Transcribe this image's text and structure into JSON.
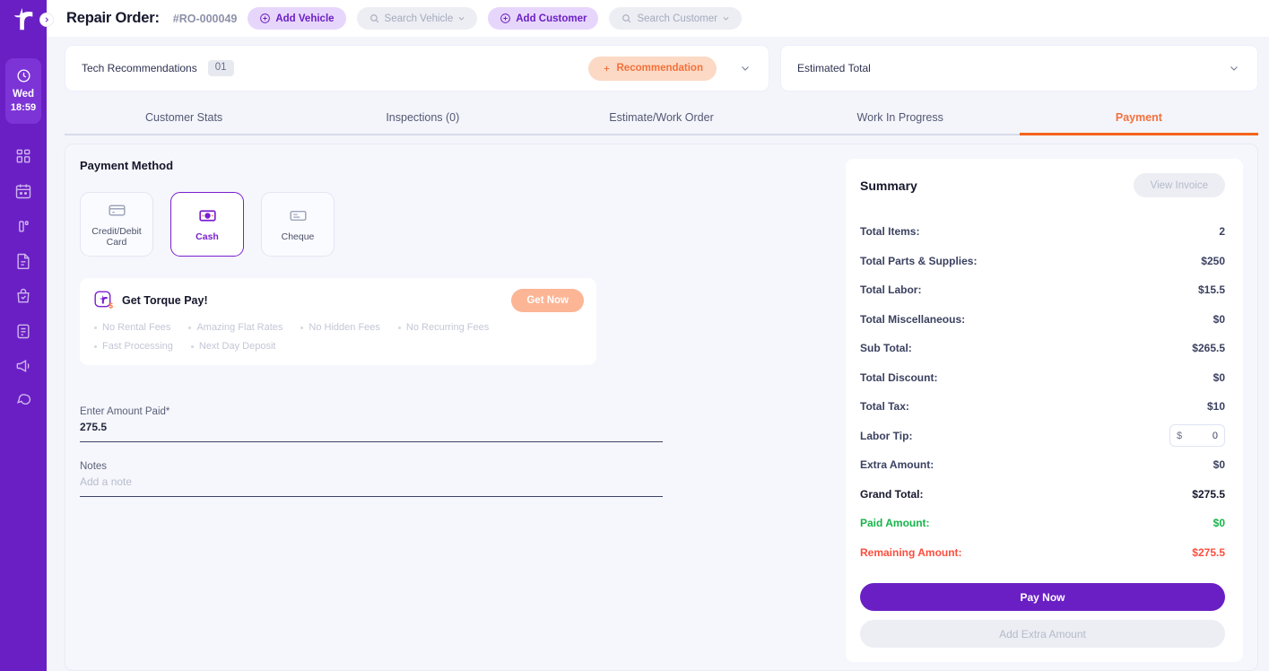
{
  "sidebar": {
    "logo_icon": "torque-logo",
    "toggle_icon": "chevron-right-icon",
    "time_widget": {
      "icon": "clock-icon",
      "day": "Wed",
      "time": "18:59"
    },
    "nav_items": [
      {
        "icon": "dashboard-grid-icon",
        "name": "dashboard"
      },
      {
        "icon": "calendar-icon",
        "name": "calendar"
      },
      {
        "icon": "chart-bars-icon",
        "name": "reports"
      },
      {
        "icon": "document-icon",
        "name": "documents"
      },
      {
        "icon": "shopping-bag-check-icon",
        "name": "orders"
      },
      {
        "icon": "clipboard-list-icon",
        "name": "inventory"
      },
      {
        "icon": "megaphone-icon",
        "name": "marketing"
      },
      {
        "icon": "chat-bubbles-icon",
        "name": "messages"
      }
    ]
  },
  "header": {
    "title": "Repair Order:",
    "order_number": "#RO-000049",
    "add_vehicle": "Add Vehicle",
    "search_vehicle": "Search Vehicle",
    "add_customer": "Add Customer",
    "search_customer": "Search Customer",
    "plus_icon": "plus-circle-icon",
    "search_icon": "search-icon",
    "chevron_icon": "chevron-down-icon"
  },
  "strips": {
    "tech_recommendations_label": "Tech Recommendations",
    "tech_recommendations_count": "01",
    "recommendation_button": "Recommendation",
    "recommendation_plus_icon": "plus-icon",
    "estimated_total_label": "Estimated Total",
    "expand_icon": "chevron-down-icon"
  },
  "tabs": [
    {
      "label": "Customer Stats",
      "active": false
    },
    {
      "label": "Inspections (0)",
      "active": false
    },
    {
      "label": "Estimate/Work Order",
      "active": false
    },
    {
      "label": "Work In Progress",
      "active": false
    },
    {
      "label": "Payment",
      "active": true
    }
  ],
  "payment": {
    "section_title": "Payment Method",
    "methods": [
      {
        "label": "Credit/Debit Card",
        "icon": "credit-card-icon",
        "selected": false
      },
      {
        "label": "Cash",
        "icon": "cash-banknote-icon",
        "selected": true
      },
      {
        "label": "Cheque",
        "icon": "cheque-icon",
        "selected": false
      }
    ],
    "promo": {
      "logo_icon": "torque-pay-logo-icon",
      "title": "Get Torque Pay!",
      "cta": "Get Now",
      "features": [
        "No Rental Fees",
        "Amazing Flat Rates",
        "No Hidden Fees",
        "No Recurring Fees",
        "Fast Processing",
        "Next Day Deposit"
      ]
    },
    "amount_label": "Enter Amount Paid*",
    "amount_value": "275.5",
    "notes_label": "Notes",
    "notes_placeholder": "Add a note",
    "notes_value": ""
  },
  "summary": {
    "title": "Summary",
    "view_invoice": "View Invoice",
    "rows": [
      {
        "key": "Total Items:",
        "value": "2",
        "style": "normal"
      },
      {
        "key": "Total Parts & Supplies:",
        "value": "$250",
        "style": "normal"
      },
      {
        "key": "Total Labor:",
        "value": "$15.5",
        "style": "normal"
      },
      {
        "key": "Total Miscellaneous:",
        "value": "$0",
        "style": "normal"
      },
      {
        "key": "Sub Total:",
        "value": "$265.5",
        "style": "normal"
      },
      {
        "key": "Total Discount:",
        "value": "$0",
        "style": "normal"
      },
      {
        "key": "Total Tax:",
        "value": "$10",
        "style": "normal"
      },
      {
        "key": "Labor Tip:",
        "value": "0",
        "style": "input",
        "currency": "$"
      },
      {
        "key": "Extra Amount:",
        "value": "$0",
        "style": "normal"
      },
      {
        "key": "Grand Total:",
        "value": "$275.5",
        "style": "total"
      },
      {
        "key": "Paid Amount:",
        "value": "$0",
        "style": "green"
      },
      {
        "key": "Remaining Amount:",
        "value": "$275.5",
        "style": "red"
      }
    ],
    "pay_now": "Pay Now",
    "add_extra": "Add Extra Amount"
  },
  "colors": {
    "brand_purple": "#6a1fc4",
    "accent_orange": "#f4713b",
    "success_green": "#17b44a",
    "danger_red": "#fb4e3d",
    "page_bg": "#f4f5fb"
  }
}
